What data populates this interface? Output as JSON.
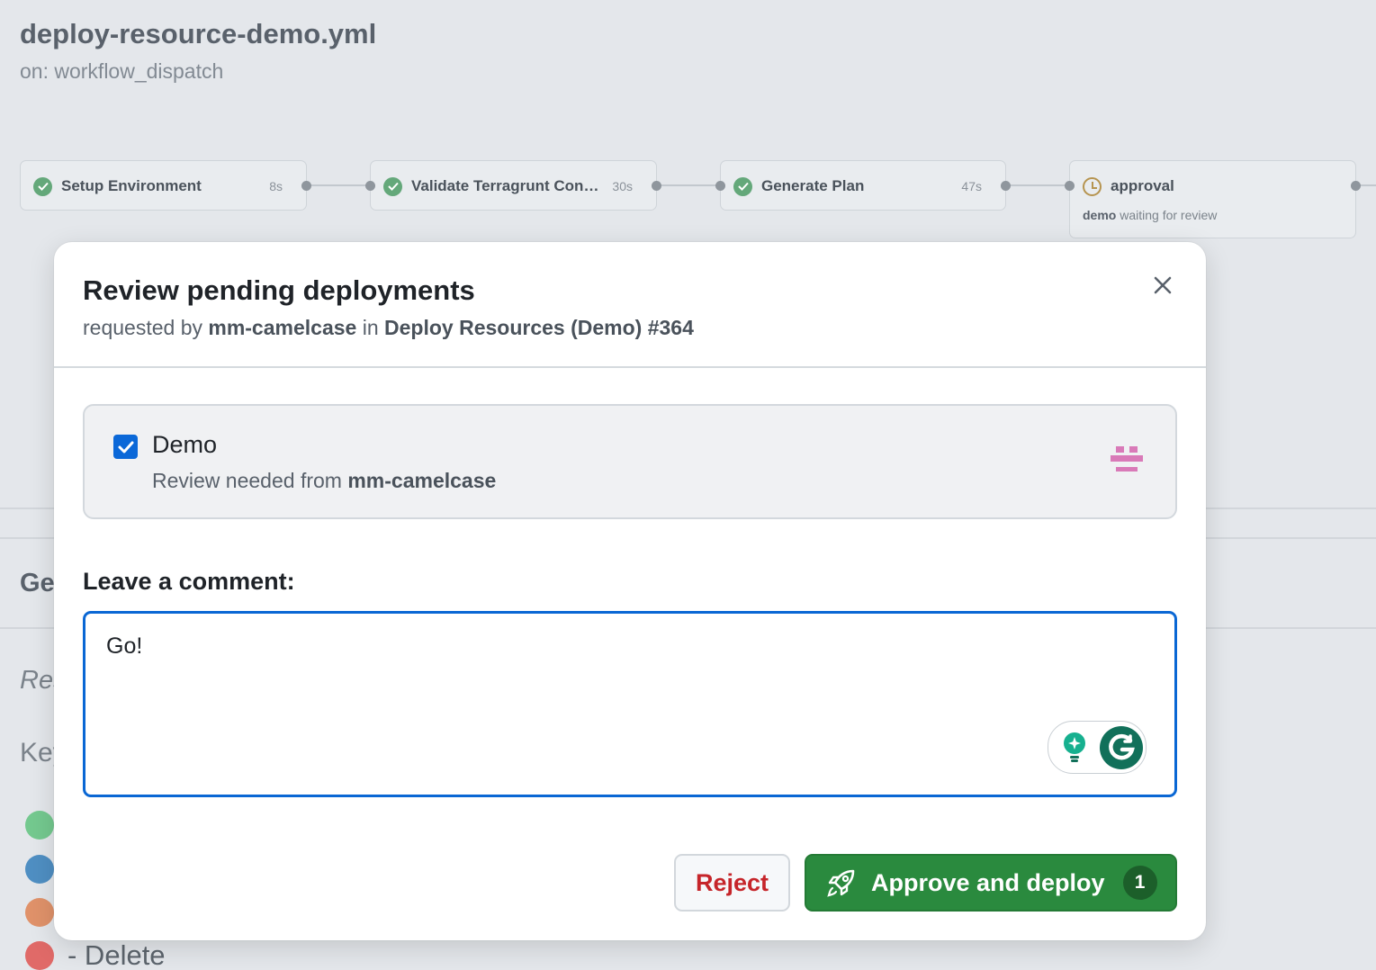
{
  "workflow": {
    "file_name": "deploy-resource-demo.yml",
    "trigger": "on: workflow_dispatch"
  },
  "jobs": [
    {
      "name": "Setup Environment",
      "duration": "8s",
      "status": "success"
    },
    {
      "name": "Validate Terragrunt Configu...",
      "duration": "30s",
      "status": "success"
    },
    {
      "name": "Generate Plan",
      "duration": "47s",
      "status": "success"
    },
    {
      "name": "approval",
      "status": "waiting",
      "environment": "demo",
      "status_text": "waiting for review"
    }
  ],
  "background": {
    "section_partial": "Ge",
    "result_partial": "Res",
    "key_partial": "Key",
    "legend_delete": "- Delete",
    "legend_colors": [
      "#74c98f",
      "#4f8fc3",
      "#e0926a",
      "#e06a68"
    ]
  },
  "modal": {
    "title": "Review pending deployments",
    "requested_by_prefix": "requested by",
    "requester": "mm-camelcase",
    "in_text": "in",
    "run_name": "Deploy Resources (Demo) #364",
    "environment": {
      "name": "Demo",
      "checked": true,
      "review_prefix": "Review needed from",
      "reviewer": "mm-camelcase"
    },
    "comment_label": "Leave a comment:",
    "comment_value": "Go!",
    "reject_label": "Reject",
    "approve_label": "Approve and deploy",
    "approve_count": "1"
  },
  "colors": {
    "approve_green": "#2a8a3e",
    "reject_red": "#c6252a",
    "focus_blue": "#0a67d4",
    "success_green": "#64a87a",
    "pending_amber": "#b6944f"
  },
  "icons": [
    "check-circle-icon",
    "clock-icon",
    "close-icon",
    "checkbox-icon",
    "identicon-avatar",
    "grammarly-bulb-icon",
    "grammarly-logo-icon",
    "rocket-icon"
  ]
}
